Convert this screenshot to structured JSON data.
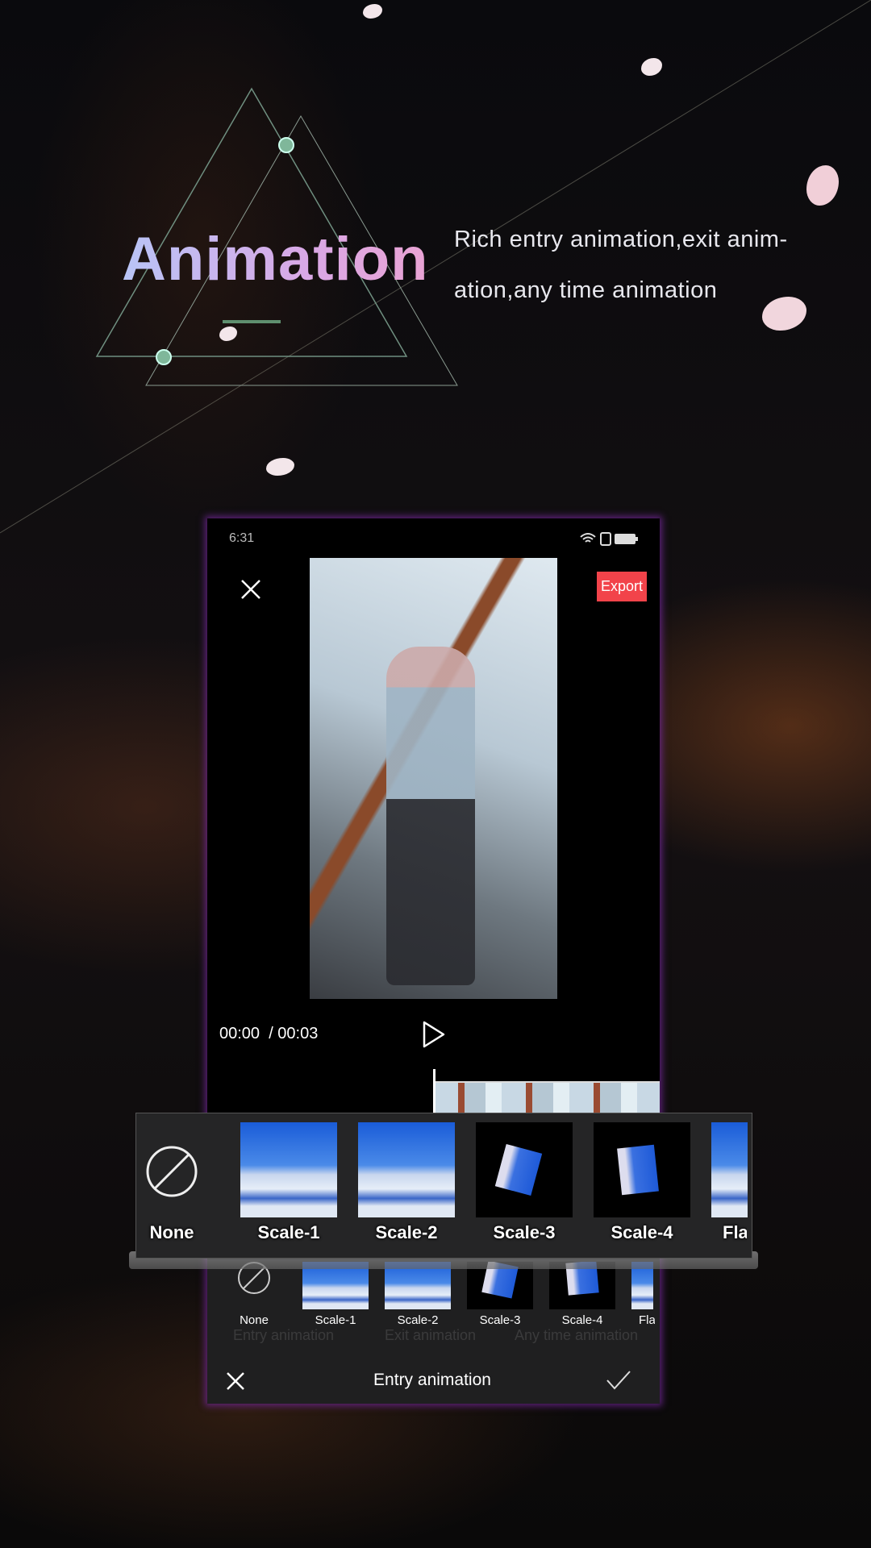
{
  "promo": {
    "title": "Animation",
    "description_lines": [
      "Rich entry animation,exit anim-",
      "ation,any time animation"
    ]
  },
  "status_bar": {
    "time": "6:31",
    "icons": [
      "wifi-icon",
      "sim-alert-icon",
      "battery-icon"
    ]
  },
  "editor": {
    "close_icon": "close-icon",
    "export_label": "Export",
    "current_time": "00:00",
    "total_time": "/ 00:03",
    "play_icon": "play-icon"
  },
  "animation_panel_zoomed": {
    "items": [
      "None",
      "Scale-1",
      "Scale-2",
      "Scale-3",
      "Scale-4",
      "Fla"
    ]
  },
  "animation_panel": {
    "items": [
      "None",
      "Scale-1",
      "Scale-2",
      "Scale-3",
      "Scale-4",
      "Fla"
    ],
    "tabs": [
      "Entry animation",
      "Exit animation",
      "Any time animation"
    ],
    "title": "Entry animation",
    "cancel_icon": "close-icon",
    "confirm_icon": "check-icon"
  },
  "colors": {
    "export": "#f2434a",
    "accent_glow": "#7828a0",
    "title_gradient": [
      "#b8c4f6",
      "#e9a3d4"
    ]
  }
}
